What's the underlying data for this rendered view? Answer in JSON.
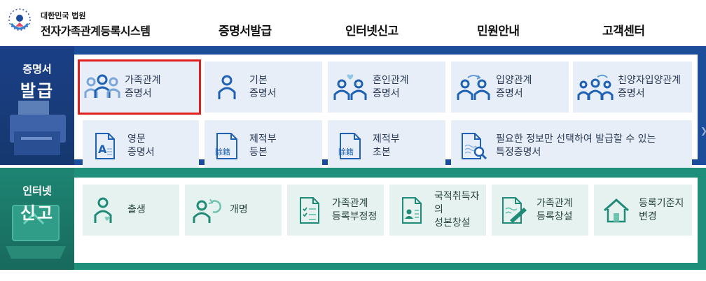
{
  "brand": {
    "org": "대한민국 법원",
    "system": "전자가족관계등록시스템"
  },
  "nav": [
    "증명서발급",
    "인터넷신고",
    "민원안내",
    "고객센터"
  ],
  "section_issue": {
    "label_top": "증명서",
    "label_bottom": "발급",
    "tiles": [
      {
        "line1": "가족관계",
        "line2": "증명서",
        "icon": "family-icon",
        "selected": true
      },
      {
        "line1": "기본",
        "line2": "증명서",
        "icon": "person-icon"
      },
      {
        "line1": "혼인관계",
        "line2": "증명서",
        "icon": "marriage-icon"
      },
      {
        "line1": "입양관계",
        "line2": "증명서",
        "icon": "adoption-icon"
      },
      {
        "line1": "친양자입양관계",
        "line2": "증명서",
        "icon": "family-adoption-icon"
      },
      {
        "line1": "영문",
        "line2": "증명서",
        "icon": "english-document-icon"
      },
      {
        "line1": "제적부",
        "line2": "등본",
        "icon": "removed-register-icon",
        "badge": "除籍"
      },
      {
        "line1": "제적부",
        "line2": "초본",
        "icon": "removed-register-icon",
        "badge": "除籍"
      },
      {
        "line1": "필요한 정보만 선택하여 발급할 수 있는",
        "line2": "특정증명서",
        "icon": "document-search-icon"
      }
    ]
  },
  "section_report": {
    "label_top": "인터넷",
    "label_bottom": "신고",
    "tiles": [
      {
        "line1": "출생",
        "line2": "",
        "icon": "birth-icon"
      },
      {
        "line1": "개명",
        "line2": "",
        "icon": "rename-icon"
      },
      {
        "line1": "가족관계",
        "line2": "등록부정정",
        "icon": "checklist-icon"
      },
      {
        "line1": "국적취득자의",
        "line2": "성본창설",
        "icon": "id-card-icon"
      },
      {
        "line1": "가족관계",
        "line2": "등록창설",
        "icon": "document-pen-icon"
      },
      {
        "line1": "등록기준지",
        "line2": "변경",
        "icon": "house-icon"
      }
    ]
  }
}
